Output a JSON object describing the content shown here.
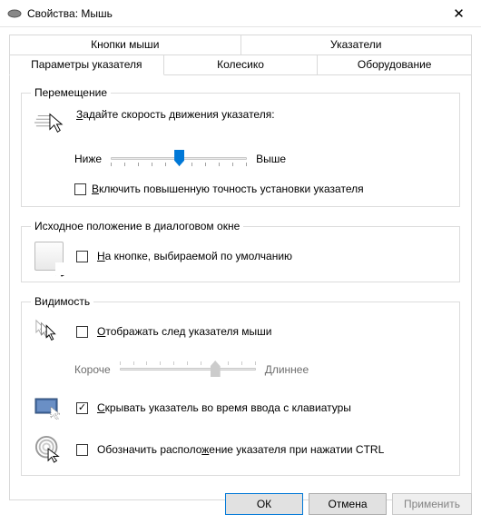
{
  "window": {
    "title": "Свойства: Мышь"
  },
  "tabs": {
    "row1": [
      "Кнопки мыши",
      "Указатели"
    ],
    "row2": [
      "Параметры указателя",
      "Колесико",
      "Оборудование"
    ],
    "active": "Параметры указателя"
  },
  "motion": {
    "legend": "Перемещение",
    "speed_label_pre": "З",
    "speed_label": "адайте скорость движения указателя:",
    "slow": "Ниже",
    "fast": "Выше",
    "slider_value": 5,
    "slider_max": 10,
    "enhance_pre": "В",
    "enhance": "ключить повышенную точность установки указателя",
    "enhance_checked": false
  },
  "snap": {
    "legend": "Исходное положение в диалоговом окне",
    "label_pre": "Н",
    "label": "а кнопке, выбираемой по умолчанию",
    "checked": false
  },
  "vis": {
    "legend": "Видимость",
    "trails_pre": "О",
    "trails": "тображать след указателя мыши",
    "trails_checked": false,
    "short": "Короче",
    "long": "Длиннее",
    "trails_value": 7,
    "trails_max": 10,
    "hide_pre": "С",
    "hide": "крывать указатель во время ввода с клавиатуры",
    "hide_checked": true,
    "ctrl_pre": "ж",
    "ctrl_before": "Обозначить располо",
    "ctrl_after": "ение указателя при нажатии CTRL",
    "ctrl_checked": false
  },
  "buttons": {
    "ok": "ОК",
    "cancel": "Отмена",
    "apply": "Применить"
  }
}
